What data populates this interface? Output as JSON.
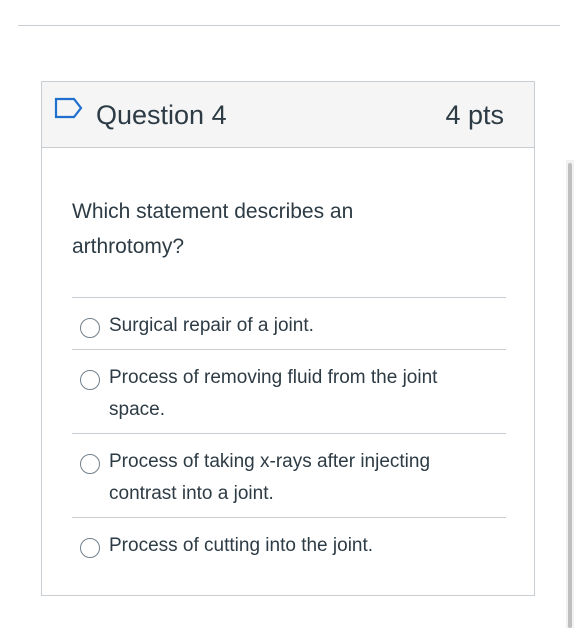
{
  "question": {
    "title": "Question 4",
    "points": "4 pts",
    "text": "Which statement describes an arthrotomy?",
    "flag_icon": "flag-outline-icon"
  },
  "answers": [
    {
      "label": "Surgical repair of a joint.",
      "selected": false
    },
    {
      "label": "Process of removing fluid from the joint space.",
      "selected": false
    },
    {
      "label": "Process of taking x-rays after injecting contrast into a joint.",
      "selected": false
    },
    {
      "label": "Process of cutting into the joint.",
      "selected": false
    }
  ],
  "colors": {
    "text": "#2d3b45",
    "border": "#c7cdd1",
    "header_bg": "#f5f5f5",
    "flag_accent": "#1f6fcf",
    "radio_border": "#73818c"
  }
}
